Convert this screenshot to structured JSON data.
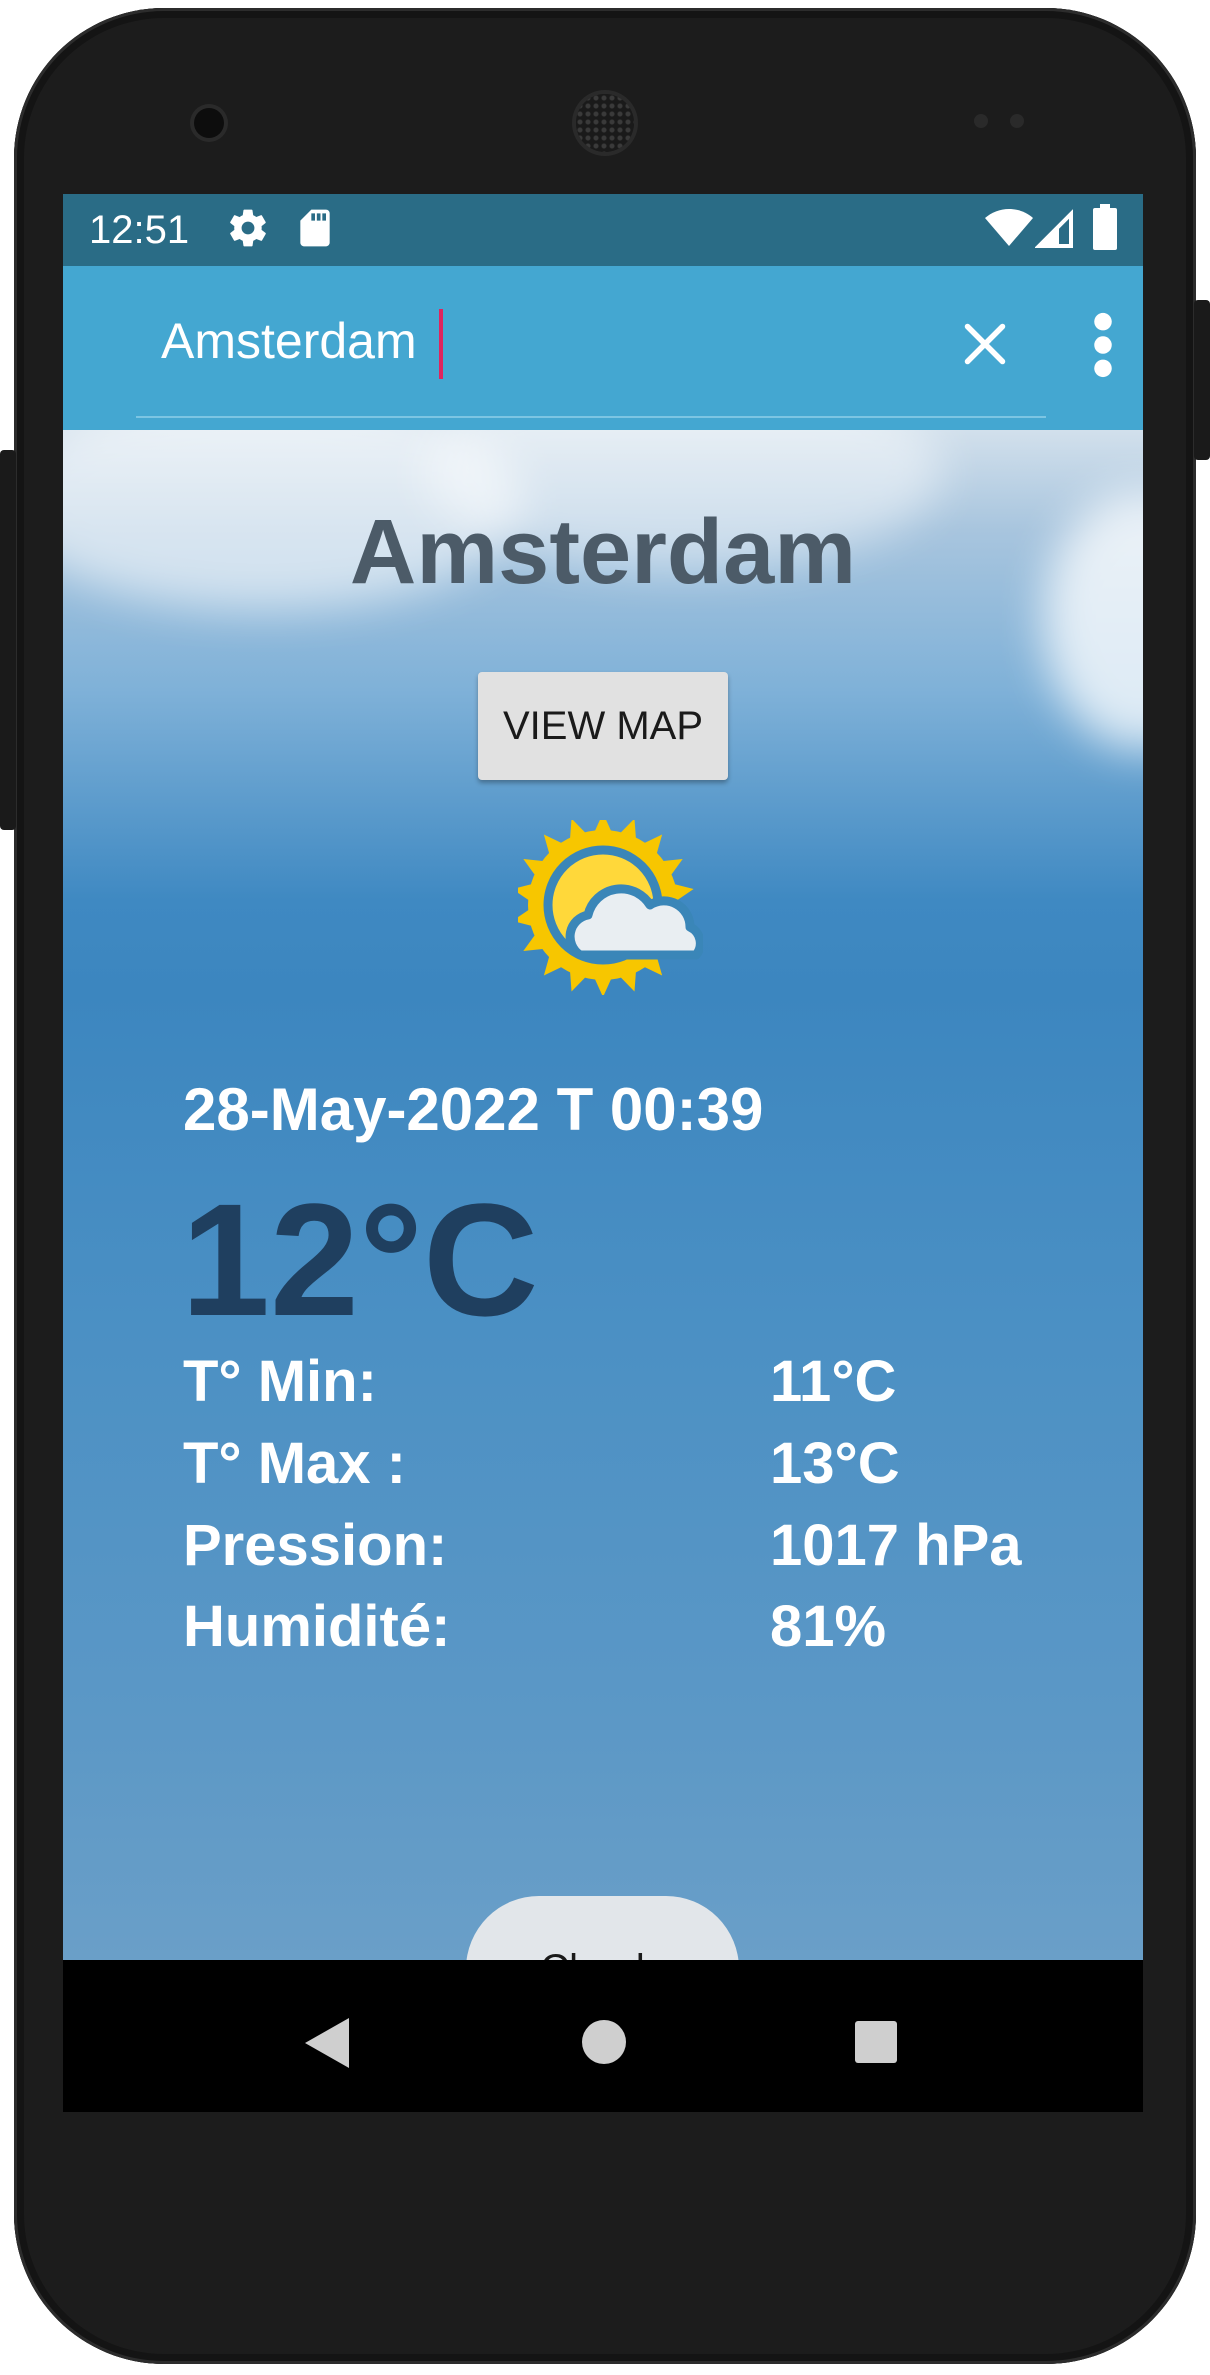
{
  "status_bar": {
    "time": "12:51",
    "icons": [
      "settings-icon",
      "sd-card-icon",
      "wifi-icon",
      "signal-icon",
      "battery-icon"
    ]
  },
  "search": {
    "value": "Amsterdam",
    "close_icon": "close-icon",
    "menu_icon": "more-vert-icon"
  },
  "weather": {
    "city": "Amsterdam",
    "view_map_label": "VIEW MAP",
    "icon": "partly-cloudy-icon",
    "datetime": "28-May-2022 T 00:39",
    "temperature": "12°C",
    "stats": [
      {
        "label": "T° Min:",
        "value": "11°C"
      },
      {
        "label": "T° Max :",
        "value": "13°C"
      },
      {
        "label": "Pression:",
        "value": "1017 hPa"
      },
      {
        "label": "Humidité:",
        "value": "81%"
      }
    ],
    "condition": "Clouds"
  },
  "nav_bar": {
    "icons": [
      "back-icon",
      "home-icon",
      "recents-icon"
    ]
  },
  "colors": {
    "status_bar": "#2a6c86",
    "app_bar": "#44a7d1",
    "cursor": "#e0245e",
    "temperature_text": "#1f3f5f",
    "city_text": "#4c5b68"
  }
}
